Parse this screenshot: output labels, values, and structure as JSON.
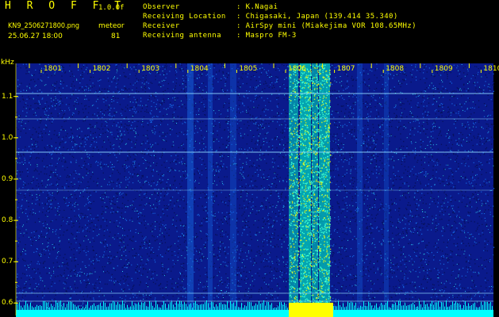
{
  "header": {
    "brand": "H R O F F T",
    "version": "1.0.0f",
    "filename": "KN9_2506271800.png",
    "meteor_label": "meteor",
    "datetime": "25.06.27 18:00",
    "meteor_count": "81",
    "info_labels": [
      "Observer",
      "Receiving Location",
      "Receiver",
      "Receiving antenna"
    ],
    "info_values": [
      ": K.Nagai",
      ": Chigasaki, Japan (139.414 35.340)",
      ": AirSpy mini (Miakejima VOR 108.65MHz)",
      ": Maspro FM-3"
    ]
  },
  "chart_data": {
    "type": "heatmap",
    "ylabel": "kHz",
    "x_ticks": [
      "1801",
      "1802",
      "1803",
      "1804",
      "1805",
      "1806",
      "1807",
      "1808",
      "1809",
      "1810"
    ],
    "y_ticks": [
      "1.1",
      "1.0",
      "0.9",
      "0.8",
      "0.7",
      "0.6"
    ],
    "ylim": [
      0.57,
      1.18
    ],
    "grid": true,
    "colors": {
      "background": "#000000",
      "noise_low": "#0a1a8c",
      "noise_mid": "#1565e0",
      "signal": "#00e0c0",
      "strong": "#ffff00",
      "labels": "#ffff00",
      "horizontal_lines": "#8fd8ff",
      "baseline": "#00ffff"
    }
  }
}
